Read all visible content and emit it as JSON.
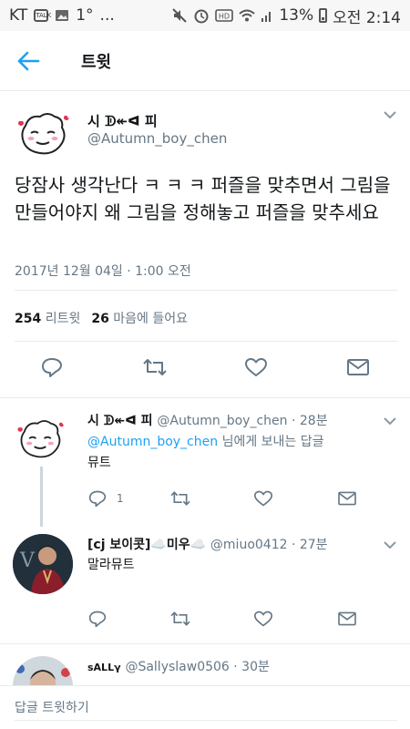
{
  "status_bar": {
    "carrier": "KT",
    "talk_icon": "TALK",
    "temperature": "1°",
    "more": "...",
    "battery": "13%",
    "time": "오전 2:14"
  },
  "header": {
    "title": "트윗"
  },
  "main_tweet": {
    "display_name": "시 ᗫ↞ᐊ 피",
    "handle": "@Autumn_boy_chen",
    "text": "당잠사 생각난다 ㅋ ㅋ ㅋ 퍼즐을 맞추면서 그림을 만들어야지 왜 그림을 정해놓고 퍼즐을 맞추세요",
    "timestamp": "2017년 12월 04일 · 1:00 오전",
    "retweet_count": "254",
    "retweet_label": "리트윗",
    "like_count": "26",
    "like_label": "마음에 들어요"
  },
  "replies": [
    {
      "display_name": "시 ᗫ↞ᐊ 피",
      "meta": "@Autumn_boy_chen · 28분",
      "reply_to_handle": "@Autumn_boy_chen",
      "reply_to_suffix": " 님에게 보내는 답글",
      "text": "뮤트",
      "reply_count": "1"
    },
    {
      "display_name": "[cj 보이콧]☁️미우☁️",
      "meta": "@miuo0412 · 27분",
      "text": "말라뮤트"
    },
    {
      "display_name": "sALLγ",
      "meta": "@Sallyslaw0506 · 30분"
    }
  ],
  "compose": {
    "placeholder": "답글 트윗하기"
  },
  "colors": {
    "accent": "#1da1f2",
    "muted": "#657786",
    "icon": "#657786"
  }
}
